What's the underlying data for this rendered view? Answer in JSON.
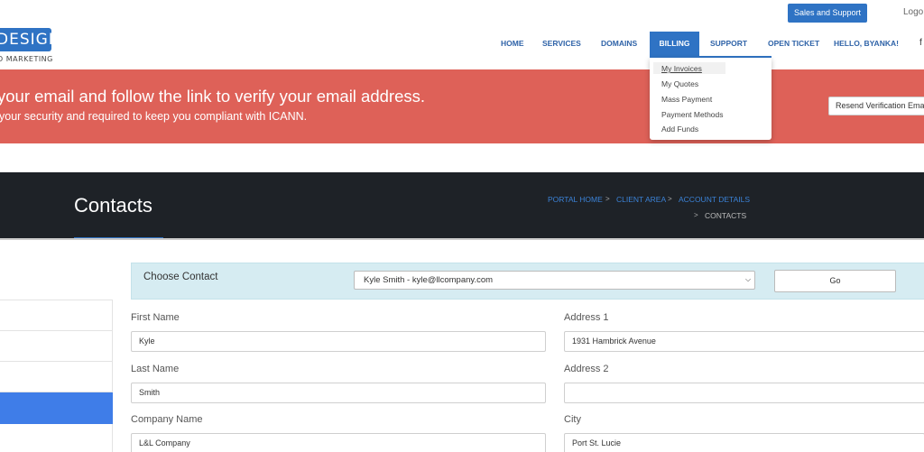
{
  "topbar": {
    "sales_support": "Sales and Support",
    "logout": "Logo"
  },
  "logo": {
    "word": "DESIGN",
    "sub": "D MARKETING"
  },
  "nav": {
    "home": "HOME",
    "services": "SERVICES",
    "domains": "DOMAINS",
    "billing": "BILLING",
    "support": "SUPPORT",
    "open_ticket": "OPEN TICKET",
    "hello": "HELLO, BYANKA!",
    "extra": "f"
  },
  "billing_menu": [
    "My Invoices",
    "My Quotes",
    "Mass Payment",
    "Payment Methods",
    "Add Funds"
  ],
  "banner": {
    "title": "your email and follow the link to verify your email address.",
    "subtitle": "your security and required to keep you compliant with ICANN.",
    "resend": "Resend Verification Email",
    "color": "#de6158"
  },
  "page": {
    "title": "Contacts",
    "breadcrumb": [
      "PORTAL HOME",
      "CLIENT AREA",
      "ACCOUNT DETAILS"
    ],
    "breadcrumb_sep": ">",
    "breadcrumb_current": "CONTACTS"
  },
  "choose": {
    "label": "Choose Contact",
    "selected": "Kyle Smith - kyle@llcompany.com",
    "go": "Go"
  },
  "form": {
    "first_name_label": "First Name",
    "first_name": "Kyle",
    "last_name_label": "Last Name",
    "last_name": "Smith",
    "company_label": "Company Name",
    "company": "L&L Company",
    "address1_label": "Address 1",
    "address1": "1931 Hambrick Avenue",
    "address2_label": "Address 2",
    "address2": "",
    "city_label": "City",
    "city": "Port St. Lucie"
  },
  "colors": {
    "accent": "#2f73c4",
    "dark_header": "#1e2227",
    "active_sidebar": "#3f7de8"
  }
}
